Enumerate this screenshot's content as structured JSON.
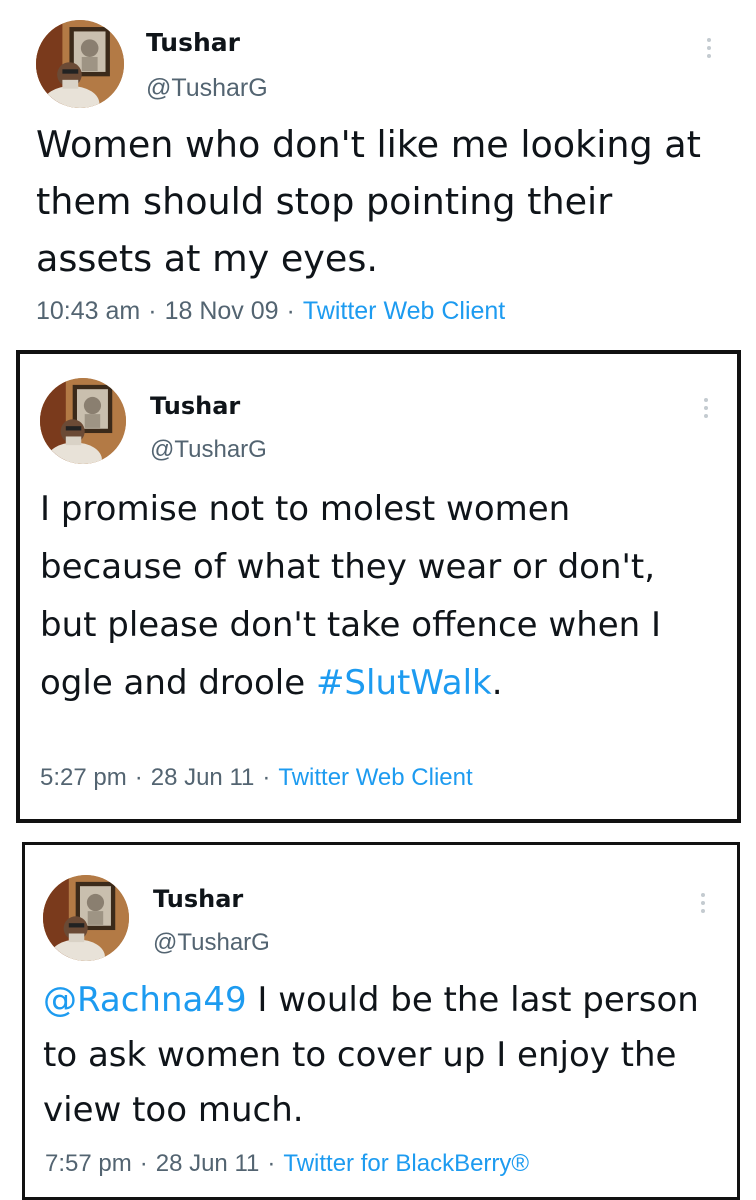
{
  "tweets": [
    {
      "name": "Tushar",
      "handle": "@TusharG",
      "text": "Women who don't like me looking at them should stop pointing their assets at my eyes.",
      "time": "10:43 am",
      "date": "18 Nov 09",
      "source": "Twitter Web Client",
      "avatar_icon": "profile-photo-icon",
      "more_icon": "more-options-icon"
    },
    {
      "name": "Tushar",
      "handle": "@TusharG",
      "text_before": "I promise not to molest women because of what they wear or don't, but please don't take offence when I ogle and droole",
      "hashtag": "#SlutWalk",
      "text_after": ".",
      "time": "5:27 pm",
      "date": "28 Jun 11",
      "source": "Twitter Web Client",
      "avatar_icon": "profile-photo-icon",
      "more_icon": "more-options-icon"
    },
    {
      "name": "Tushar",
      "handle": "@TusharG",
      "mention": "@Rachna49",
      "text_after": " I would be the last person to ask women to cover up I enjoy the view too much.",
      "time": "7:57 pm",
      "date": "28 Jun 11",
      "source": "Twitter for BlackBerry®",
      "avatar_icon": "profile-photo-icon",
      "more_icon": "more-options-icon"
    }
  ],
  "separator": "·",
  "colors": {
    "text": "#0f1419",
    "secondary": "#536471",
    "link": "#1d9bf0",
    "border": "#111111"
  }
}
